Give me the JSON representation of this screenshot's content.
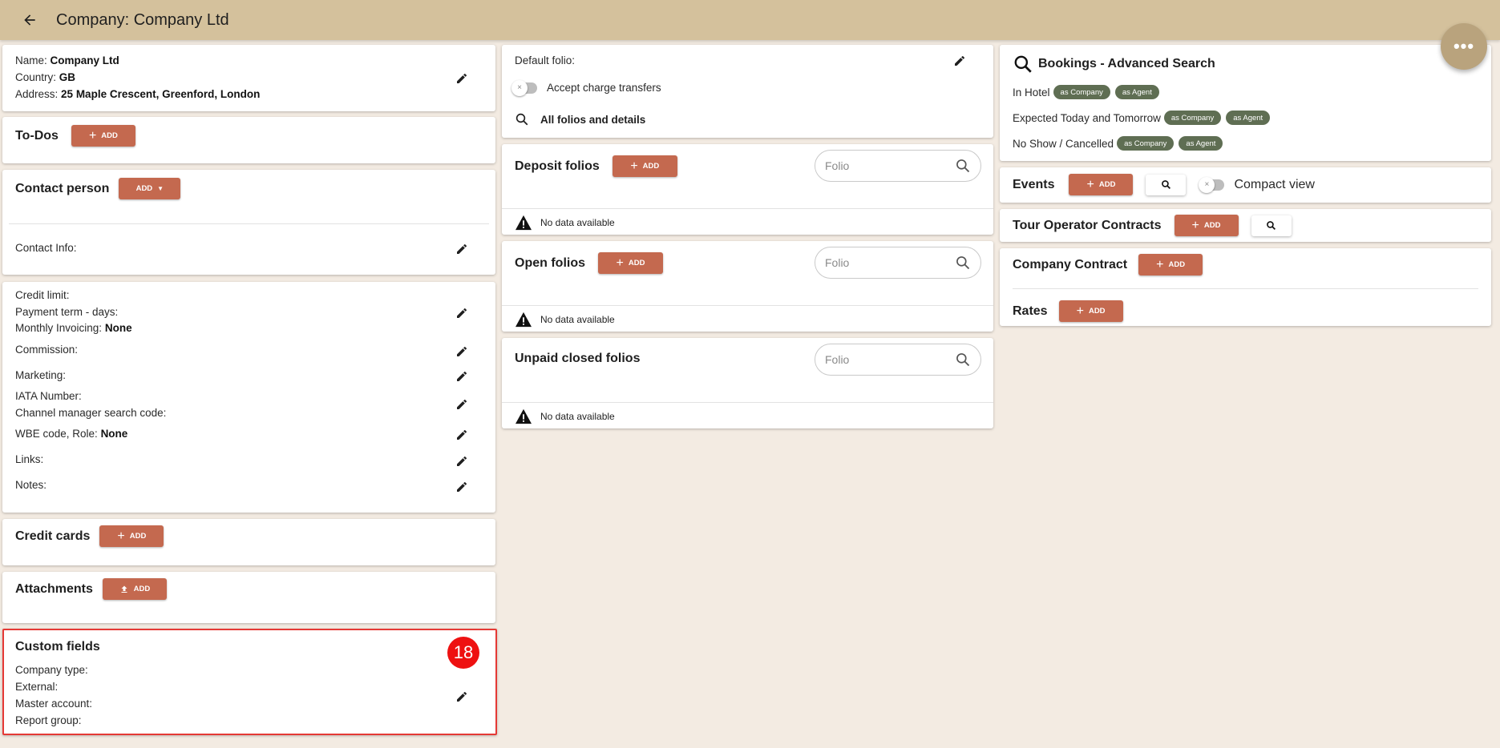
{
  "header": {
    "title": "Company: Company Ltd"
  },
  "company": {
    "name_label": "Name:",
    "name_value": "Company Ltd",
    "country_label": "Country:",
    "country_value": "GB",
    "address_label": "Address:",
    "address_value": "25 Maple Crescent, Greenford, London"
  },
  "todos": {
    "title": "To-Dos",
    "add_label": "ADD"
  },
  "contact": {
    "title": "Contact person",
    "add_label": "ADD",
    "info_label": "Contact Info:"
  },
  "details": {
    "credit_limit": "Credit limit:",
    "payment_term": "Payment term - days:",
    "monthly_invoicing_label": "Monthly Invoicing:",
    "monthly_invoicing_value": "None",
    "commission": "Commission:",
    "marketing": "Marketing:",
    "iata": "IATA Number:",
    "channel_manager": "Channel manager search code:",
    "wbe_label": "WBE code, Role:",
    "wbe_value": "None",
    "links": "Links:",
    "notes": "Notes:"
  },
  "credit_cards": {
    "title": "Credit cards",
    "add_label": "ADD"
  },
  "attachments": {
    "title": "Attachments",
    "add_label": "ADD"
  },
  "custom_fields": {
    "title": "Custom fields",
    "badge": "18",
    "company_type": "Company type:",
    "external": "External:",
    "master_account": "Master account:",
    "report_group": "Report group:"
  },
  "folio_settings": {
    "default_folio": "Default folio:",
    "accept_charge_transfers": "Accept charge transfers",
    "all_folios": "All folios and details"
  },
  "deposit_folios": {
    "title": "Deposit folios",
    "add_label": "ADD",
    "search_placeholder": "Folio",
    "empty": "No data available"
  },
  "open_folios": {
    "title": "Open folios",
    "add_label": "ADD",
    "search_placeholder": "Folio",
    "empty": "No data available"
  },
  "unpaid_folios": {
    "title": "Unpaid closed folios",
    "search_placeholder": "Folio",
    "empty": "No data available"
  },
  "bookings": {
    "title": "Bookings - Advanced Search",
    "rows": [
      {
        "label": "In Hotel",
        "chip1": "as Company",
        "chip2": "as Agent"
      },
      {
        "label": "Expected Today and Tomorrow",
        "chip1": "as Company",
        "chip2": "as Agent"
      },
      {
        "label": "No Show / Cancelled",
        "chip1": "as Company",
        "chip2": "as Agent"
      }
    ]
  },
  "events": {
    "title": "Events",
    "add_label": "ADD",
    "compact_view": "Compact view"
  },
  "tour_operator": {
    "title": "Tour Operator Contracts",
    "add_label": "ADD"
  },
  "company_contract": {
    "title": "Company Contract",
    "add_label": "ADD"
  },
  "rates": {
    "title": "Rates",
    "add_label": "ADD"
  },
  "colors": {
    "accent": "#c4694f",
    "topbar": "#d4c19c",
    "chip": "#5f6e53",
    "background": "#f3ebe2",
    "highlight": "#e53935"
  }
}
